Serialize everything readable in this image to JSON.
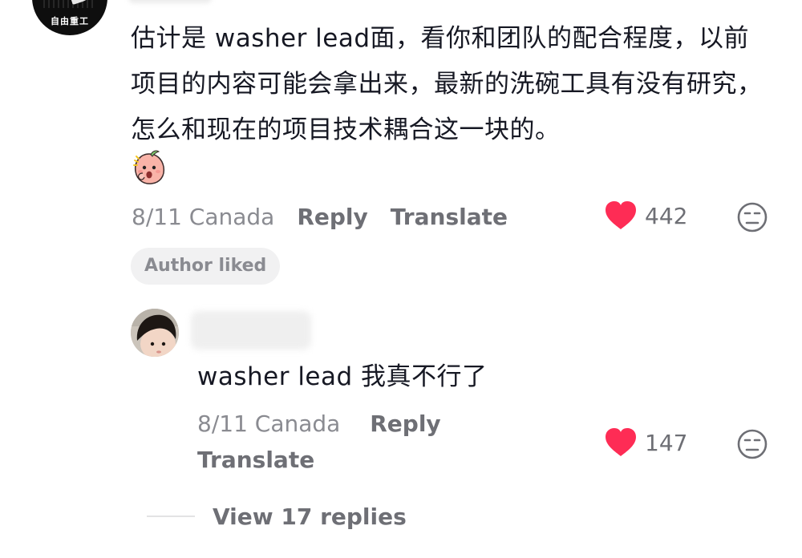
{
  "comment": {
    "avatar_text": "自由重工",
    "text": "估计是 washer lead面，看你和团队的配合程度，以前项目的内容可能会拿出来，最新的洗碗工具有没有研究，怎么和现在的项目技术耦合这一块的。",
    "emoji_icon": "shocked-peach-emoji-icon",
    "date_location": "8/11 Canada",
    "reply_label": "Reply",
    "translate_label": "Translate",
    "like_count": "442",
    "author_liked_label": "Author liked"
  },
  "reply": {
    "text": "washer lead 我真不行了",
    "date_location": "8/11 Canada",
    "reply_label": "Reply",
    "translate_label": "Translate",
    "like_count": "147"
  },
  "view_replies_label": "View 17 replies",
  "colors": {
    "heart": "#fe2c55",
    "secondary_text": "#8a8b91",
    "action_text": "#6e6f75",
    "primary_text": "#161823",
    "chip_bg": "#f1f1f2"
  }
}
